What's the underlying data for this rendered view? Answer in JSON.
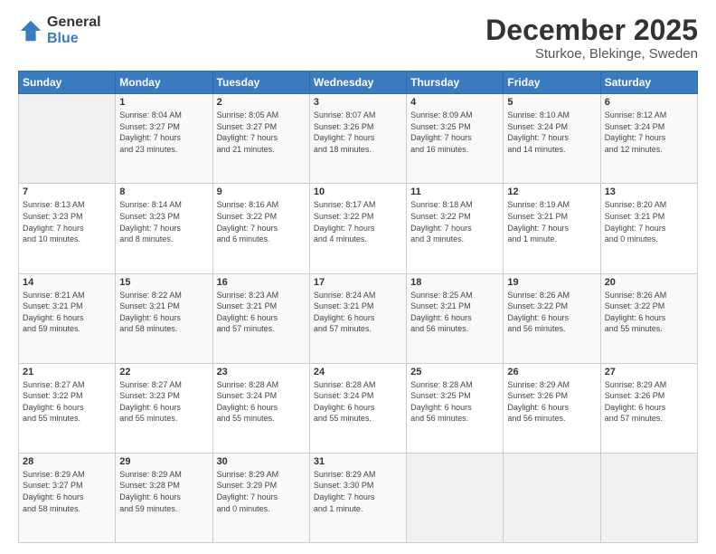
{
  "logo": {
    "general": "General",
    "blue": "Blue"
  },
  "header": {
    "month": "December 2025",
    "location": "Sturkoe, Blekinge, Sweden"
  },
  "days_of_week": [
    "Sunday",
    "Monday",
    "Tuesday",
    "Wednesday",
    "Thursday",
    "Friday",
    "Saturday"
  ],
  "weeks": [
    [
      {
        "day": "",
        "info": ""
      },
      {
        "day": "1",
        "info": "Sunrise: 8:04 AM\nSunset: 3:27 PM\nDaylight: 7 hours\nand 23 minutes."
      },
      {
        "day": "2",
        "info": "Sunrise: 8:05 AM\nSunset: 3:27 PM\nDaylight: 7 hours\nand 21 minutes."
      },
      {
        "day": "3",
        "info": "Sunrise: 8:07 AM\nSunset: 3:26 PM\nDaylight: 7 hours\nand 18 minutes."
      },
      {
        "day": "4",
        "info": "Sunrise: 8:09 AM\nSunset: 3:25 PM\nDaylight: 7 hours\nand 16 minutes."
      },
      {
        "day": "5",
        "info": "Sunrise: 8:10 AM\nSunset: 3:24 PM\nDaylight: 7 hours\nand 14 minutes."
      },
      {
        "day": "6",
        "info": "Sunrise: 8:12 AM\nSunset: 3:24 PM\nDaylight: 7 hours\nand 12 minutes."
      }
    ],
    [
      {
        "day": "7",
        "info": "Sunrise: 8:13 AM\nSunset: 3:23 PM\nDaylight: 7 hours\nand 10 minutes."
      },
      {
        "day": "8",
        "info": "Sunrise: 8:14 AM\nSunset: 3:23 PM\nDaylight: 7 hours\nand 8 minutes."
      },
      {
        "day": "9",
        "info": "Sunrise: 8:16 AM\nSunset: 3:22 PM\nDaylight: 7 hours\nand 6 minutes."
      },
      {
        "day": "10",
        "info": "Sunrise: 8:17 AM\nSunset: 3:22 PM\nDaylight: 7 hours\nand 4 minutes."
      },
      {
        "day": "11",
        "info": "Sunrise: 8:18 AM\nSunset: 3:22 PM\nDaylight: 7 hours\nand 3 minutes."
      },
      {
        "day": "12",
        "info": "Sunrise: 8:19 AM\nSunset: 3:21 PM\nDaylight: 7 hours\nand 1 minute."
      },
      {
        "day": "13",
        "info": "Sunrise: 8:20 AM\nSunset: 3:21 PM\nDaylight: 7 hours\nand 0 minutes."
      }
    ],
    [
      {
        "day": "14",
        "info": "Sunrise: 8:21 AM\nSunset: 3:21 PM\nDaylight: 6 hours\nand 59 minutes."
      },
      {
        "day": "15",
        "info": "Sunrise: 8:22 AM\nSunset: 3:21 PM\nDaylight: 6 hours\nand 58 minutes."
      },
      {
        "day": "16",
        "info": "Sunrise: 8:23 AM\nSunset: 3:21 PM\nDaylight: 6 hours\nand 57 minutes."
      },
      {
        "day": "17",
        "info": "Sunrise: 8:24 AM\nSunset: 3:21 PM\nDaylight: 6 hours\nand 57 minutes."
      },
      {
        "day": "18",
        "info": "Sunrise: 8:25 AM\nSunset: 3:21 PM\nDaylight: 6 hours\nand 56 minutes."
      },
      {
        "day": "19",
        "info": "Sunrise: 8:26 AM\nSunset: 3:22 PM\nDaylight: 6 hours\nand 56 minutes."
      },
      {
        "day": "20",
        "info": "Sunrise: 8:26 AM\nSunset: 3:22 PM\nDaylight: 6 hours\nand 55 minutes."
      }
    ],
    [
      {
        "day": "21",
        "info": "Sunrise: 8:27 AM\nSunset: 3:22 PM\nDaylight: 6 hours\nand 55 minutes."
      },
      {
        "day": "22",
        "info": "Sunrise: 8:27 AM\nSunset: 3:23 PM\nDaylight: 6 hours\nand 55 minutes."
      },
      {
        "day": "23",
        "info": "Sunrise: 8:28 AM\nSunset: 3:24 PM\nDaylight: 6 hours\nand 55 minutes."
      },
      {
        "day": "24",
        "info": "Sunrise: 8:28 AM\nSunset: 3:24 PM\nDaylight: 6 hours\nand 55 minutes."
      },
      {
        "day": "25",
        "info": "Sunrise: 8:28 AM\nSunset: 3:25 PM\nDaylight: 6 hours\nand 56 minutes."
      },
      {
        "day": "26",
        "info": "Sunrise: 8:29 AM\nSunset: 3:26 PM\nDaylight: 6 hours\nand 56 minutes."
      },
      {
        "day": "27",
        "info": "Sunrise: 8:29 AM\nSunset: 3:26 PM\nDaylight: 6 hours\nand 57 minutes."
      }
    ],
    [
      {
        "day": "28",
        "info": "Sunrise: 8:29 AM\nSunset: 3:27 PM\nDaylight: 6 hours\nand 58 minutes."
      },
      {
        "day": "29",
        "info": "Sunrise: 8:29 AM\nSunset: 3:28 PM\nDaylight: 6 hours\nand 59 minutes."
      },
      {
        "day": "30",
        "info": "Sunrise: 8:29 AM\nSunset: 3:29 PM\nDaylight: 7 hours\nand 0 minutes."
      },
      {
        "day": "31",
        "info": "Sunrise: 8:29 AM\nSunset: 3:30 PM\nDaylight: 7 hours\nand 1 minute."
      },
      {
        "day": "",
        "info": ""
      },
      {
        "day": "",
        "info": ""
      },
      {
        "day": "",
        "info": ""
      }
    ]
  ]
}
